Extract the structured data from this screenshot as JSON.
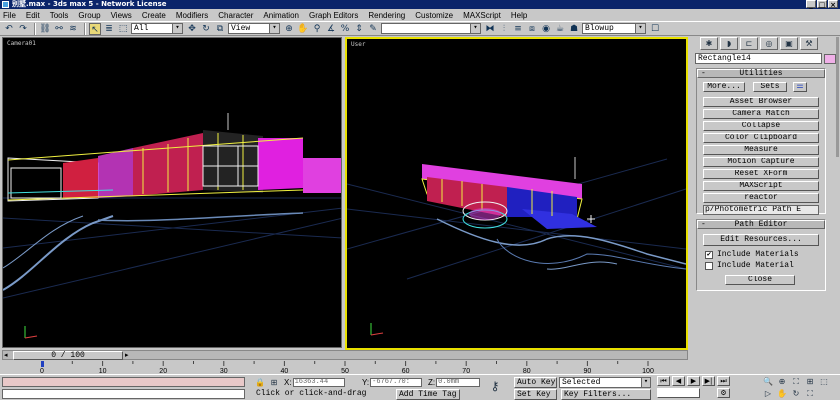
{
  "window": {
    "title": "别墅.max - 3ds max 5 - Network License"
  },
  "menu": [
    "File",
    "Edit",
    "Tools",
    "Group",
    "Views",
    "Create",
    "Modifiers",
    "Character",
    "Animation",
    "Graph Editors",
    "Rendering",
    "Customize",
    "MAXScript",
    "Help"
  ],
  "toolbar": {
    "selection_filter": "All",
    "reference_coord": "View",
    "named_selection": "",
    "render_type": "Blowup"
  },
  "viewports": {
    "left_label": "Camera01",
    "right_label": "User"
  },
  "command_panel": {
    "object_name": "Rectangle14",
    "object_color": "#f0b0e8",
    "utilities": {
      "header": "Utilities",
      "collapse_sign": "-",
      "more_label": "More...",
      "sets_label": "Sets",
      "buttons": [
        "Asset Browser",
        "Camera Match",
        "Collapse",
        "Color Clipboard",
        "Measure",
        "Motion Capture",
        "Reset XForm",
        "MAXScript",
        "reactor"
      ],
      "extra_field": "p/Photometric Path E"
    },
    "path_editor": {
      "header": "Path Editor",
      "collapse_sign": "-",
      "edit_resources_label": "Edit Resources...",
      "include_materials_label": "Include Materials",
      "include_materials_checked": true,
      "include_material_label": "Include Material",
      "include_material_checked": false,
      "close_label": "Close"
    }
  },
  "timeline": {
    "frame_display": "0 / 100",
    "current_frame": 0,
    "total_frames": 100,
    "ticks": [
      "0",
      "10",
      "20",
      "30",
      "40",
      "50",
      "60",
      "70",
      "80",
      "90",
      "100"
    ]
  },
  "status": {
    "x_label": "X:",
    "x_value": "16363.44",
    "y_label": "Y:",
    "y_value": "-6767.70:",
    "z_label": "Z:",
    "z_value": "0.0mm",
    "prompt": "Click or click-and-drag",
    "add_time_tag": "Add Time Tag",
    "auto_key": "Auto Key",
    "set_key": "Set Key",
    "key_mode": "Selected",
    "key_filters": "Key Filters..."
  }
}
